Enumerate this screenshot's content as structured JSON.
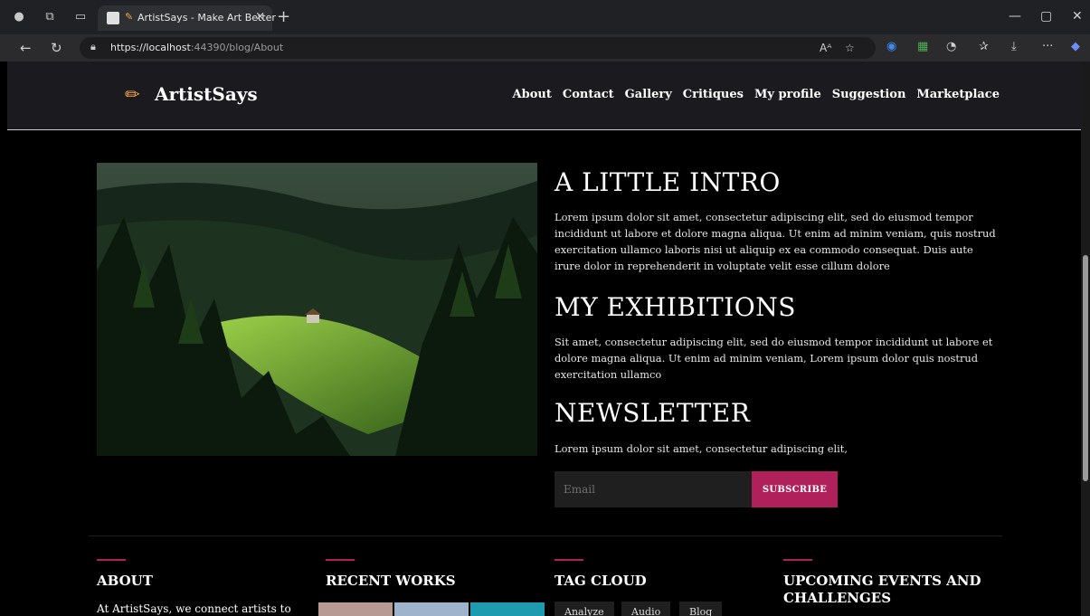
{
  "browser": {
    "tab_title": "ArtistSays - Make Art Better",
    "tab_close": "×",
    "new_tab": "+",
    "url_host": "https://localhost",
    "url_path": ":44390/blog/About",
    "read_aloud": "Aᴬ",
    "favorite": "☆",
    "menu": "···",
    "minimize": "—",
    "restore": "▢",
    "close": "✕",
    "back": "←",
    "reload": "↻"
  },
  "site": {
    "brand": "ArtistSays",
    "nav": [
      "About",
      "Contact",
      "Gallery",
      "Critiques",
      "My profile",
      "Suggestion",
      "Marketplace"
    ]
  },
  "intro": {
    "title": "A LITTLE INTRO",
    "body": "Lorem ipsum dolor sit amet, consectetur adipiscing elit, sed do eiusmod tempor incididunt ut labore et dolore magna aliqua. Ut enim ad minim veniam, quis nostrud exercitation ullamco laboris nisi ut aliquip ex ea commodo consequat. Duis aute irure dolor in reprehenderit in voluptate velit esse cillum dolore"
  },
  "exhibitions": {
    "title": "MY EXHIBITIONS",
    "body": "Sit amet, consectetur adipiscing elit, sed do eiusmod tempor incididunt ut labore et dolore magna aliqua. Ut enim ad minim veniam, Lorem ipsum dolor quis nostrud exercitation ullamco"
  },
  "newsletter": {
    "title": "NEWSLETTER",
    "body": "Lorem ipsum dolor sit amet, consectetur adipiscing elit,",
    "email_placeholder": "Email",
    "subscribe_label": "SUBSCRIBE"
  },
  "footer": {
    "about_title": "ABOUT",
    "about_text": "At ArtistSays, we connect artists to",
    "recent_title": "RECENT WORKS",
    "tags_title": "TAG CLOUD",
    "tags": [
      "Analyze",
      "Audio",
      "Blog"
    ],
    "events_title": "UPCOMING EVENTS AND CHALLENGES"
  },
  "colors": {
    "accent": "#b0205a",
    "brand_icon": "#f5a44a",
    "header_bg": "#1b1b1f",
    "page_bg": "#000000"
  }
}
